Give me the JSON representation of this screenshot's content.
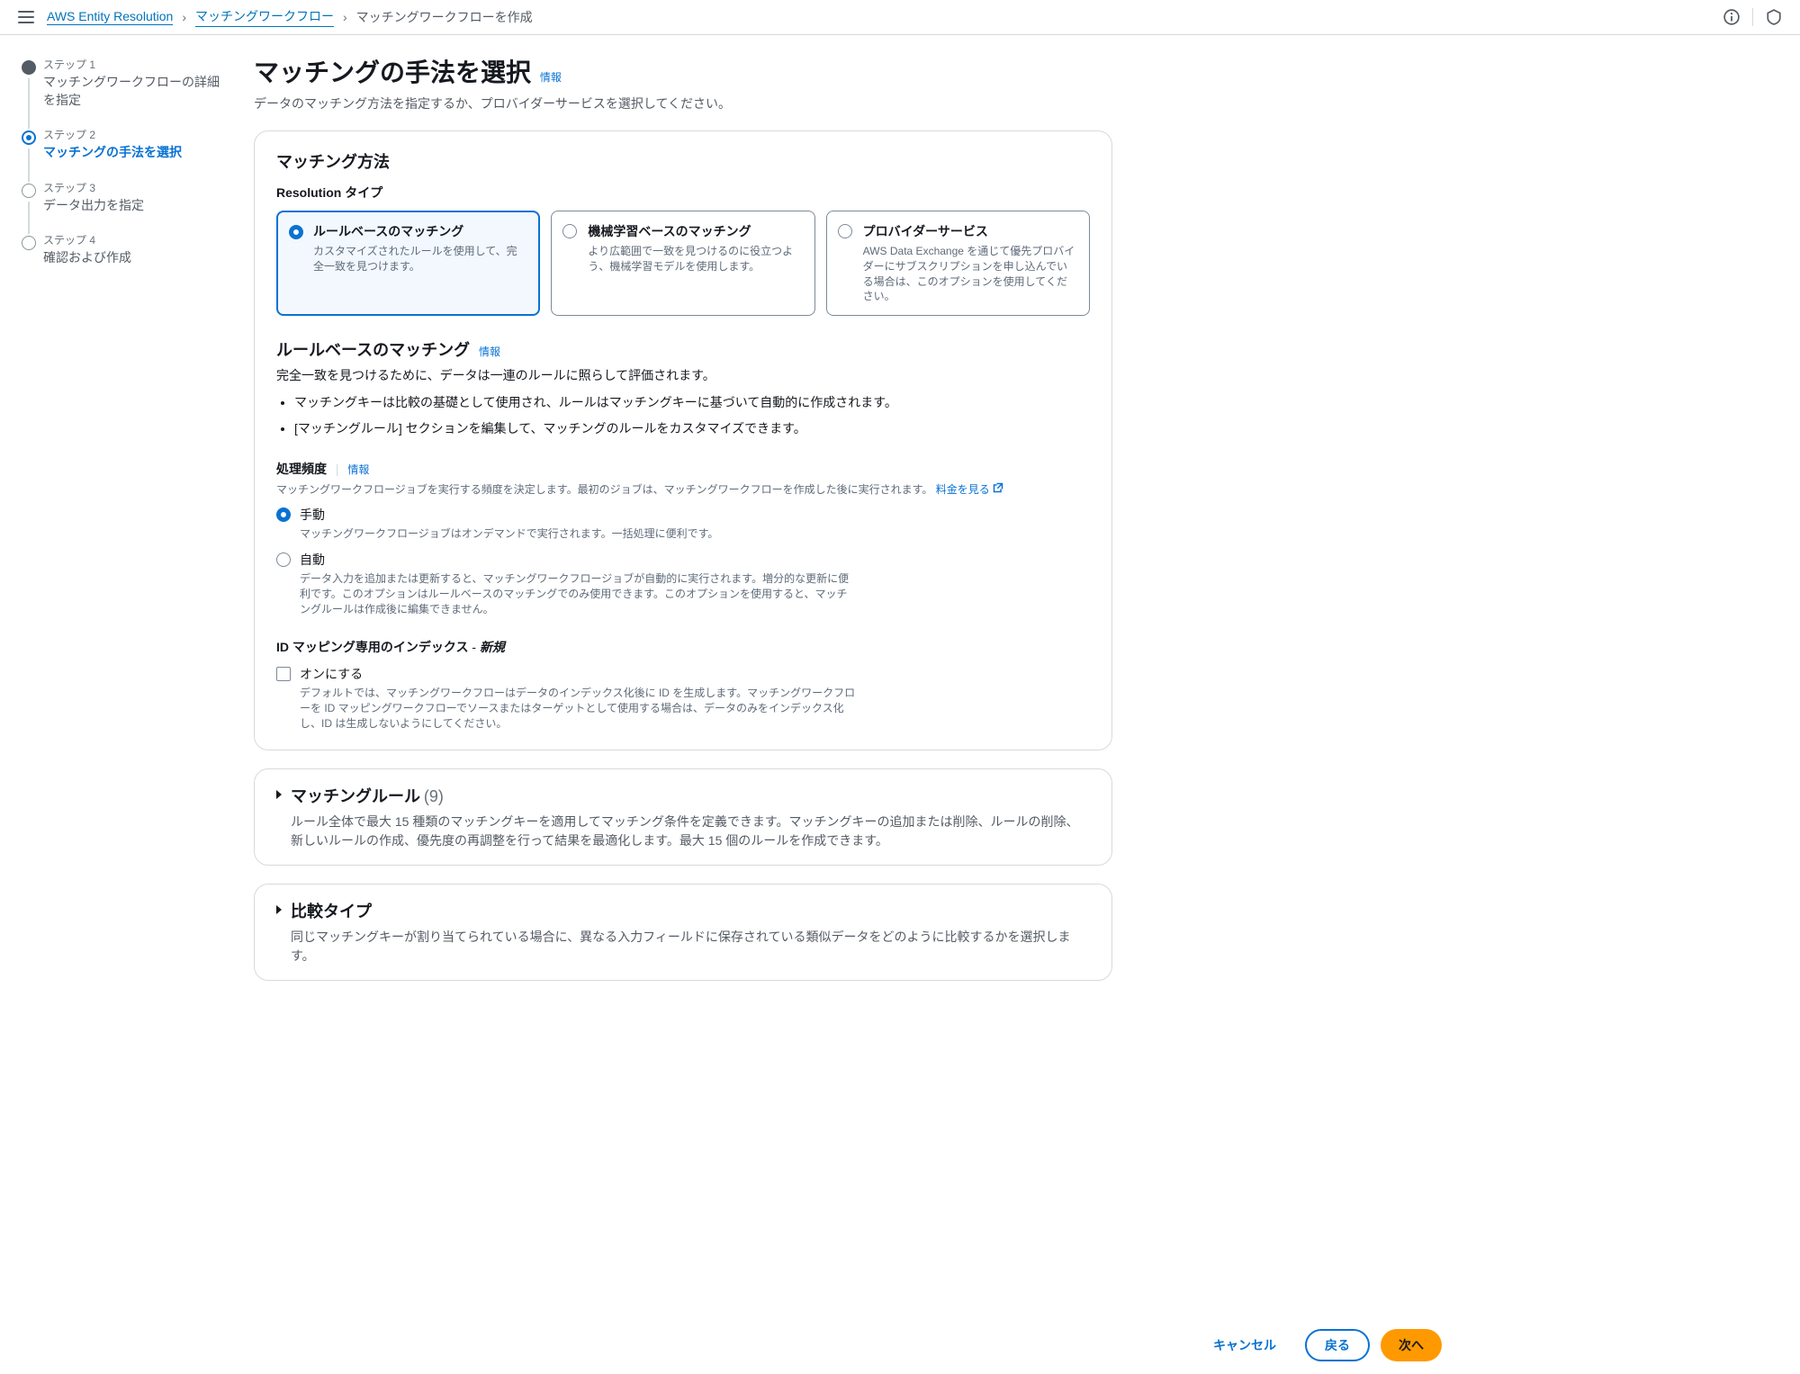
{
  "breadcrumb": {
    "root": "AWS Entity Resolution",
    "mid": "マッチングワークフロー",
    "current": "マッチングワークフローを作成"
  },
  "wizard": {
    "steps": [
      {
        "label": "ステップ 1",
        "title": "マッチングワークフローの詳細を指定"
      },
      {
        "label": "ステップ 2",
        "title": "マッチングの手法を選択"
      },
      {
        "label": "ステップ 3",
        "title": "データ出力を指定"
      },
      {
        "label": "ステップ 4",
        "title": "確認および作成"
      }
    ]
  },
  "header": {
    "title": "マッチングの手法を選択",
    "info": "情報",
    "desc": "データのマッチング方法を指定するか、プロバイダーサービスを選択してください。"
  },
  "method": {
    "panel_title": "マッチング方法",
    "type_label": "Resolution タイプ",
    "tiles": [
      {
        "title": "ルールベースのマッチング",
        "desc": "カスタマイズされたルールを使用して、完全一致を見つけます。"
      },
      {
        "title": "機械学習ベースのマッチング",
        "desc": "より広範囲で一致を見つけるのに役立つよう、機械学習モデルを使用します。"
      },
      {
        "title": "プロバイダーサービス",
        "desc": "AWS Data Exchange を通じて優先プロバイダーにサブスクリプションを申し込んでいる場合は、このオプションを使用してください。"
      }
    ]
  },
  "rule": {
    "title": "ルールベースのマッチング",
    "info": "情報",
    "desc": "完全一致を見つけるために、データは一連のルールに照らして評価されます。",
    "bullets": [
      "マッチングキーは比較の基礎として使用され、ルールはマッチングキーに基づいて自動的に作成されます。",
      "[マッチングルール] セクションを編集して、マッチングのルールをカスタマイズできます。"
    ]
  },
  "cadence": {
    "label": "処理頻度",
    "info": "情報",
    "help": "マッチングワークフロージョブを実行する頻度を決定します。最初のジョブは、マッチングワークフローを作成した後に実行されます。",
    "pricing": "料金を見る",
    "opts": [
      {
        "title": "手動",
        "desc": "マッチングワークフロージョブはオンデマンドで実行されます。一括処理に便利です。"
      },
      {
        "title": "自動",
        "desc": "データ入力を追加または更新すると、マッチングワークフロージョブが自動的に実行されます。増分的な更新に便利です。このオプションはルールベースのマッチングでのみ使用できます。このオプションを使用すると、マッチングルールは作成後に編集できません。"
      }
    ]
  },
  "idmap": {
    "label": "ID マッピング専用のインデックス",
    "new": "新規",
    "cb_title": "オンにする",
    "cb_desc": "デフォルトでは、マッチングワークフローはデータのインデックス化後に ID を生成します。マッチングワークフローを ID マッピングワークフローでソースまたはターゲットとして使用する場合は、データのみをインデックス化し、ID は生成しないようにしてください。"
  },
  "expand": {
    "rules": {
      "title": "マッチングルール",
      "count": "(9)",
      "desc": "ルール全体で最大 15 種類のマッチングキーを適用してマッチング条件を定義できます。マッチングキーの追加または削除、ルールの削除、新しいルールの作成、優先度の再調整を行って結果を最適化します。最大 15 個のルールを作成できます。"
    },
    "compare": {
      "title": "比較タイプ",
      "desc": "同じマッチングキーが割り当てられている場合に、異なる入力フィールドに保存されている類似データをどのように比較するかを選択します。"
    }
  },
  "footer": {
    "cancel": "キャンセル",
    "back": "戻る",
    "next": "次へ"
  }
}
